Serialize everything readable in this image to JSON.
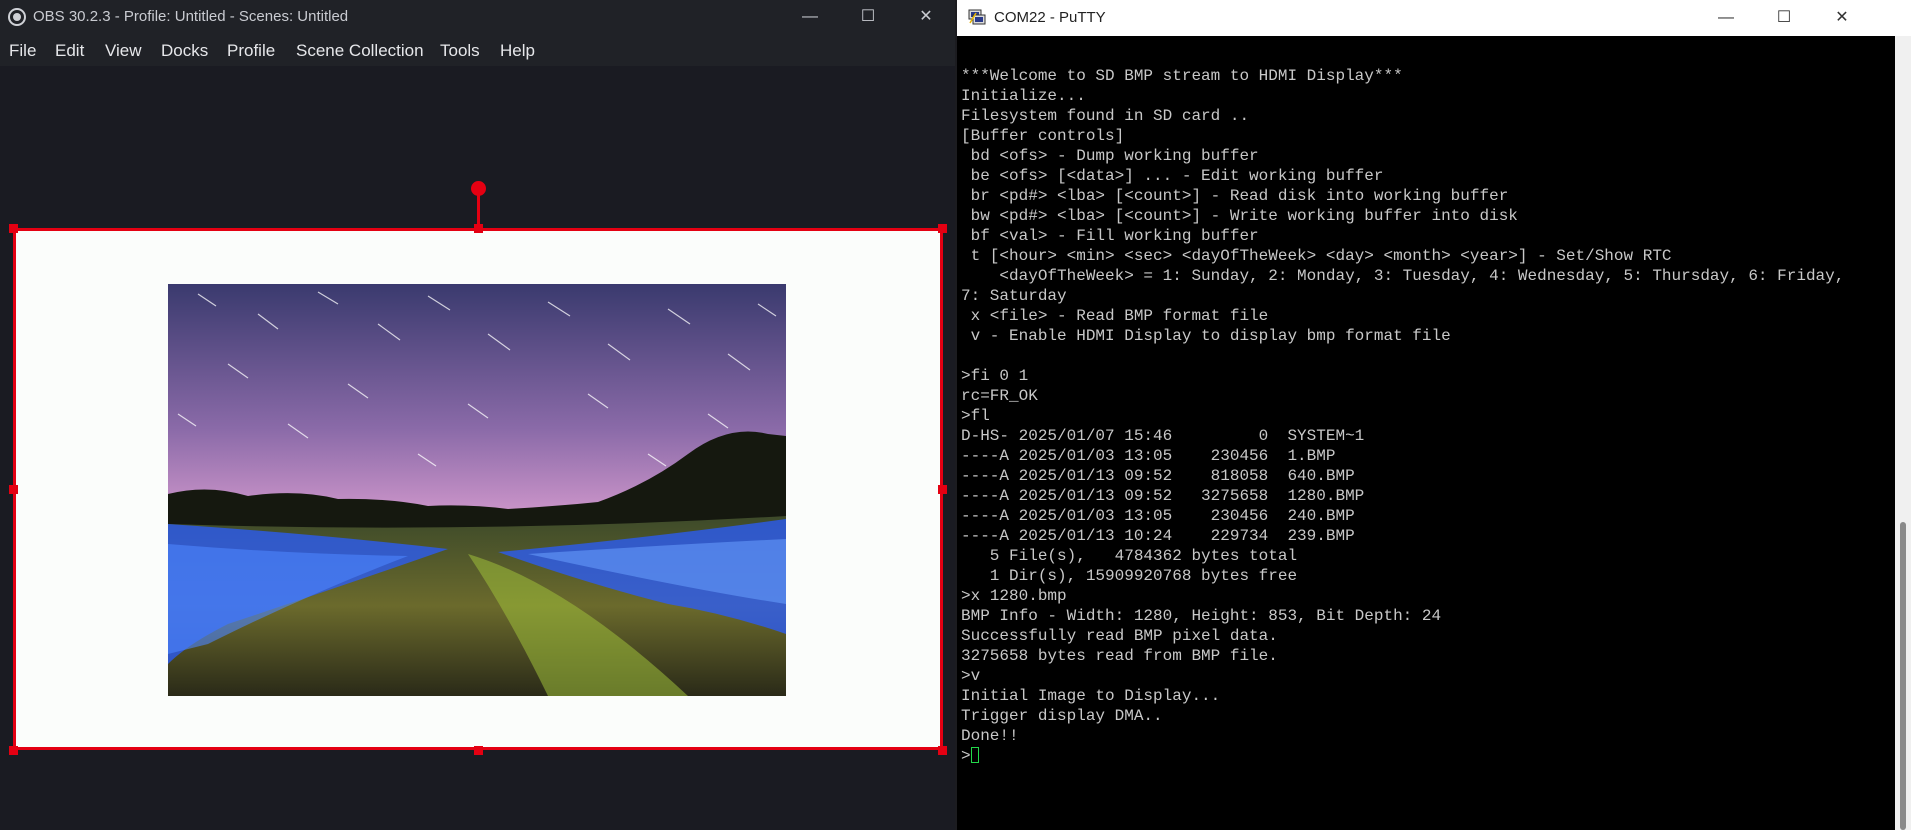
{
  "obs": {
    "title": "OBS 30.2.3 - Profile: Untitled - Scenes: Untitled",
    "menu": [
      "File",
      "Edit",
      "View",
      "Docks",
      "Profile",
      "Scene Collection",
      "Tools",
      "Help"
    ],
    "window_controls": {
      "minimize": "—",
      "maximize": "☐",
      "close": "✕"
    },
    "selection_color": "#e40012",
    "preview_background": "#fbfdfb",
    "preview_image": "night sky star trails over a field with blue light-painted waves"
  },
  "putty": {
    "title": "COM22 - PuTTY",
    "window_controls": {
      "minimize": "—",
      "maximize": "☐",
      "close": "✕"
    },
    "lines": [
      "***Welcome to SD BMP stream to HDMI Display***",
      "Initialize...",
      "Filesystem found in SD card ..",
      "[Buffer controls]",
      " bd <ofs> - Dump working buffer",
      " be <ofs> [<data>] ... - Edit working buffer",
      " br <pd#> <lba> [<count>] - Read disk into working buffer",
      " bw <pd#> <lba> [<count>] - Write working buffer into disk",
      " bf <val> - Fill working buffer",
      " t [<hour> <min> <sec> <dayOfTheWeek> <day> <month> <year>] - Set/Show RTC",
      "    <dayOfTheWeek> = 1: Sunday, 2: Monday, 3: Tuesday, 4: Wednesday, 5: Thursday, 6: Friday,",
      "7: Saturday",
      " x <file> - Read BMP format file",
      " v - Enable HDMI Display to display bmp format file",
      "",
      ">fi 0 1",
      "rc=FR_OK",
      ">fl",
      "D-HS- 2025/01/07 15:46         0  SYSTEM~1",
      "----A 2025/01/03 13:05    230456  1.BMP",
      "----A 2025/01/13 09:52    818058  640.BMP",
      "----A 2025/01/13 09:52   3275658  1280.BMP",
      "----A 2025/01/03 13:05    230456  240.BMP",
      "----A 2025/01/13 10:24    229734  239.BMP",
      "   5 File(s),   4784362 bytes total",
      "   1 Dir(s), 15909920768 bytes free",
      ">x 1280.bmp",
      "BMP Info - Width: 1280, Height: 853, Bit Depth: 24",
      "Successfully read BMP pixel data.",
      "3275658 bytes read from BMP file.",
      ">v",
      "Initial Image to Display...",
      "Trigger display DMA..",
      "Done!!"
    ],
    "prompt": ">",
    "text_color": "#c8c8c8",
    "cursor_color": "#22d94a"
  }
}
